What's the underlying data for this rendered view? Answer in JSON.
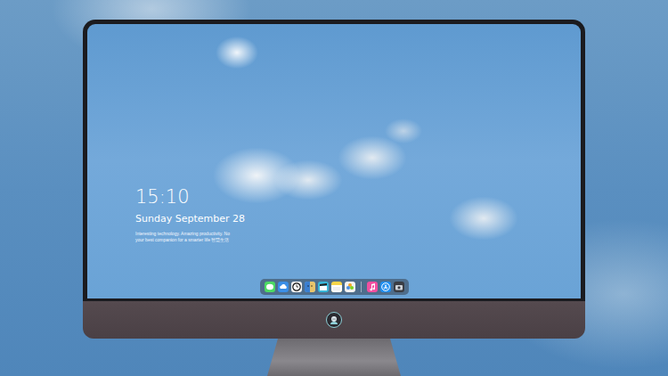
{
  "lock_screen": {
    "time": "15:10",
    "date": "Sunday September 28",
    "message_lines": [
      "Interesting technology. Amazing productivity. No",
      "your best companion for a smarter life 智慧生活"
    ]
  },
  "dock": {
    "apps": [
      {
        "kind": "messages",
        "color": "#4cd964"
      },
      {
        "kind": "drive",
        "color": "#3a8ee6"
      },
      {
        "kind": "clock",
        "color": "#f4f4f4"
      },
      {
        "kind": "finder",
        "color": "#6fb6e8"
      },
      {
        "kind": "video",
        "color": "#39b6d8"
      },
      {
        "kind": "notes",
        "color": "#f7d54a"
      },
      {
        "kind": "photos",
        "color": "#f2f2f2"
      }
    ],
    "extras": [
      {
        "kind": "music",
        "color": "#f24fa0"
      },
      {
        "kind": "appstore",
        "color": "#1f8ef1"
      },
      {
        "kind": "camera",
        "color": "#3a3d44"
      }
    ]
  }
}
